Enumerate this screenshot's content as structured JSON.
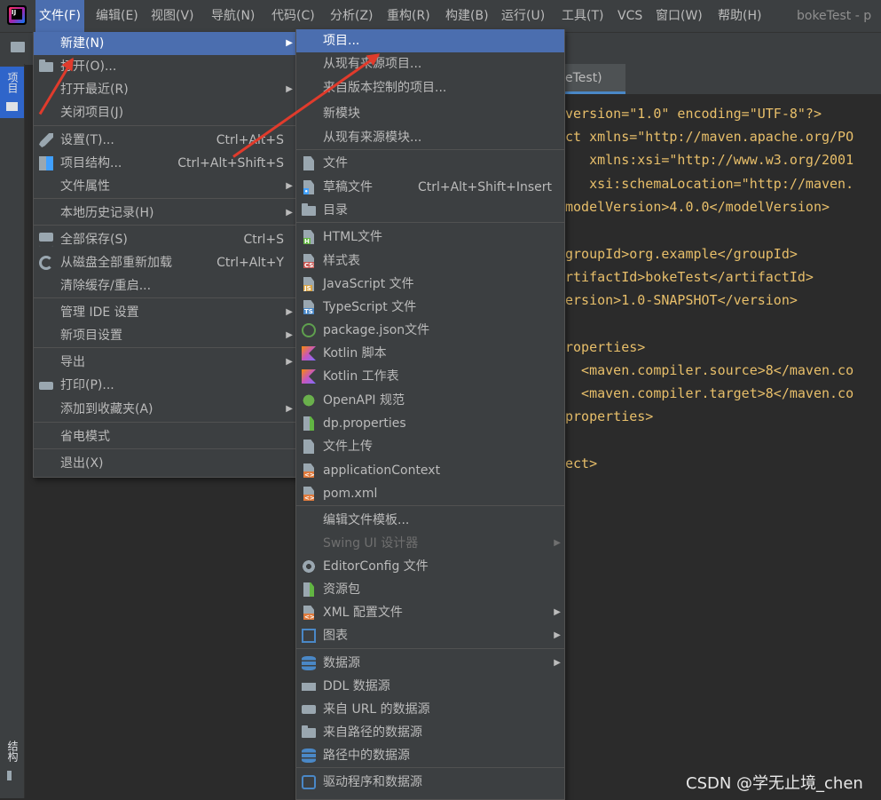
{
  "menubar": {
    "items": [
      {
        "label": "文件(F)"
      },
      {
        "label": "编辑(E)"
      },
      {
        "label": "视图(V)"
      },
      {
        "label": "导航(N)"
      },
      {
        "label": "代码(C)"
      },
      {
        "label": "分析(Z)"
      },
      {
        "label": "重构(R)"
      },
      {
        "label": "构建(B)"
      },
      {
        "label": "运行(U)"
      },
      {
        "label": "工具(T)"
      },
      {
        "label": "VCS"
      },
      {
        "label": "窗口(W)"
      },
      {
        "label": "帮助(H)"
      }
    ],
    "window_title": "bokeTest - p"
  },
  "side_tabs": {
    "project": "项目",
    "structure": "结构"
  },
  "editor": {
    "tab_label": "eTest)",
    "lines": [
      [
        "version=\"1.0\" encoding=\"UTF-8\"?>"
      ],
      [
        "ct xmlns=\"http://maven.apache.org/PO"
      ],
      [
        "   xmlns:xsi=\"http://www.w3.org/2001"
      ],
      [
        "   xsi:schemaLocation=\"http://maven."
      ],
      [
        "modelVersion>4.0.0</modelVersion>"
      ],
      [
        "groupId>org.example</groupId>"
      ],
      [
        "rtifactId>bokeTest</artifactId>"
      ],
      [
        "ersion>1.0-SNAPSHOT</version>"
      ],
      [
        "roperties>"
      ],
      [
        "  <maven.compiler.source>8</maven.co"
      ],
      [
        "  <maven.compiler.target>8</maven.co"
      ],
      [
        "properties>"
      ],
      [
        "ect>"
      ]
    ]
  },
  "file_menu": {
    "items": [
      {
        "label": "新建(N)",
        "shortcut": "",
        "submenu": true,
        "icon": ""
      },
      {
        "label": "打开(O)...",
        "shortcut": "",
        "submenu": false,
        "icon": "folder-open-icon"
      },
      {
        "label": "打开最近(R)",
        "shortcut": "",
        "submenu": true,
        "icon": ""
      },
      {
        "label": "关闭项目(J)",
        "shortcut": "",
        "submenu": false,
        "icon": ""
      },
      {
        "label": "设置(T)...",
        "shortcut": "Ctrl+Alt+S",
        "submenu": false,
        "icon": "wrench-icon"
      },
      {
        "label": "项目结构...",
        "shortcut": "Ctrl+Alt+Shift+S",
        "submenu": false,
        "icon": "project-structure-icon"
      },
      {
        "label": "文件属性",
        "shortcut": "",
        "submenu": true,
        "icon": ""
      },
      {
        "label": "本地历史记录(H)",
        "shortcut": "",
        "submenu": true,
        "icon": ""
      },
      {
        "label": "全部保存(S)",
        "shortcut": "Ctrl+S",
        "submenu": false,
        "icon": "save-icon"
      },
      {
        "label": "从磁盘全部重新加载",
        "shortcut": "Ctrl+Alt+Y",
        "submenu": false,
        "icon": "reload-icon"
      },
      {
        "label": "清除缓存/重启...",
        "shortcut": "",
        "submenu": false,
        "icon": ""
      },
      {
        "label": "管理 IDE 设置",
        "shortcut": "",
        "submenu": true,
        "icon": ""
      },
      {
        "label": "新项目设置",
        "shortcut": "",
        "submenu": true,
        "icon": ""
      },
      {
        "label": "导出",
        "shortcut": "",
        "submenu": true,
        "icon": ""
      },
      {
        "label": "打印(P)...",
        "shortcut": "",
        "submenu": false,
        "icon": "print-icon"
      },
      {
        "label": "添加到收藏夹(A)",
        "shortcut": "",
        "submenu": true,
        "icon": ""
      },
      {
        "label": "省电模式",
        "shortcut": "",
        "submenu": false,
        "icon": ""
      },
      {
        "label": "退出(X)",
        "shortcut": "",
        "submenu": false,
        "icon": ""
      }
    ]
  },
  "new_menu": {
    "items": [
      {
        "label": "项目...",
        "shortcut": "",
        "submenu": false,
        "icon": "",
        "disabled": false
      },
      {
        "label": "从现有来源项目...",
        "shortcut": "",
        "submenu": false,
        "icon": "",
        "disabled": false
      },
      {
        "label": "来自版本控制的项目...",
        "shortcut": "",
        "submenu": false,
        "icon": "",
        "disabled": false
      },
      {
        "label": "新模块",
        "shortcut": "",
        "submenu": false,
        "icon": "",
        "disabled": false
      },
      {
        "label": "从现有来源模块...",
        "shortcut": "",
        "submenu": false,
        "icon": "",
        "disabled": false
      },
      {
        "label": "文件",
        "shortcut": "",
        "submenu": false,
        "icon": "file-icon",
        "disabled": false
      },
      {
        "label": "草稿文件",
        "shortcut": "Ctrl+Alt+Shift+Insert",
        "submenu": false,
        "icon": "scratch-file-icon",
        "disabled": false
      },
      {
        "label": "目录",
        "shortcut": "",
        "submenu": false,
        "icon": "directory-icon",
        "disabled": false
      },
      {
        "label": "HTML文件",
        "shortcut": "",
        "submenu": false,
        "icon": "html-file-icon",
        "disabled": false
      },
      {
        "label": "样式表",
        "shortcut": "",
        "submenu": false,
        "icon": "css-file-icon",
        "disabled": false
      },
      {
        "label": "JavaScript 文件",
        "shortcut": "",
        "submenu": false,
        "icon": "javascript-file-icon",
        "disabled": false
      },
      {
        "label": "TypeScript 文件",
        "shortcut": "",
        "submenu": false,
        "icon": "typescript-file-icon",
        "disabled": false
      },
      {
        "label": "package.json文件",
        "shortcut": "",
        "submenu": false,
        "icon": "nodejs-icon",
        "disabled": false
      },
      {
        "label": "Kotlin 脚本",
        "shortcut": "",
        "submenu": false,
        "icon": "kotlin-script-icon",
        "disabled": false
      },
      {
        "label": "Kotlin 工作表",
        "shortcut": "",
        "submenu": false,
        "icon": "kotlin-worksheet-icon",
        "disabled": false
      },
      {
        "label": "OpenAPI 规范",
        "shortcut": "",
        "submenu": false,
        "icon": "openapi-icon",
        "disabled": false
      },
      {
        "label": "dp.properties",
        "shortcut": "",
        "submenu": false,
        "icon": "properties-file-icon",
        "disabled": false
      },
      {
        "label": "文件上传",
        "shortcut": "",
        "submenu": false,
        "icon": "file-upload-icon",
        "disabled": false
      },
      {
        "label": "applicationContext",
        "shortcut": "",
        "submenu": false,
        "icon": "xml-file-icon",
        "disabled": false
      },
      {
        "label": "pom.xml",
        "shortcut": "",
        "submenu": false,
        "icon": "xml-file-icon",
        "disabled": false
      },
      {
        "label": "编辑文件模板...",
        "shortcut": "",
        "submenu": false,
        "icon": "",
        "disabled": false
      },
      {
        "label": "Swing UI 设计器",
        "shortcut": "",
        "submenu": true,
        "icon": "",
        "disabled": true
      },
      {
        "label": "EditorConfig 文件",
        "shortcut": "",
        "submenu": false,
        "icon": "gear-icon",
        "disabled": false
      },
      {
        "label": "资源包",
        "shortcut": "",
        "submenu": false,
        "icon": "resource-bundle-icon",
        "disabled": false
      },
      {
        "label": "XML 配置文件",
        "shortcut": "",
        "submenu": true,
        "icon": "xml-config-icon",
        "disabled": false
      },
      {
        "label": "图表",
        "shortcut": "",
        "submenu": true,
        "icon": "diagram-icon",
        "disabled": false
      },
      {
        "label": "数据源",
        "shortcut": "",
        "submenu": true,
        "icon": "database-icon",
        "disabled": false
      },
      {
        "label": "DDL 数据源",
        "shortcut": "",
        "submenu": false,
        "icon": "ddl-icon",
        "disabled": false
      },
      {
        "label": "来自 URL 的数据源",
        "shortcut": "",
        "submenu": false,
        "icon": "url-datasource-icon",
        "disabled": false
      },
      {
        "label": "来自路径的数据源",
        "shortcut": "",
        "submenu": false,
        "icon": "folder-open-icon",
        "disabled": false
      },
      {
        "label": "路径中的数据源",
        "shortcut": "",
        "submenu": false,
        "icon": "database-icon",
        "disabled": false
      },
      {
        "label": "驱动程序和数据源",
        "shortcut": "",
        "submenu": false,
        "icon": "driver-icon",
        "disabled": false
      }
    ]
  },
  "colors": {
    "selection": "#4b6eaf",
    "menu_bg": "#3c3f41",
    "editor_bg": "#2b2b2b",
    "annotation_arrow": "#e03b2c"
  },
  "watermark": "CSDN @学无止境_chen"
}
